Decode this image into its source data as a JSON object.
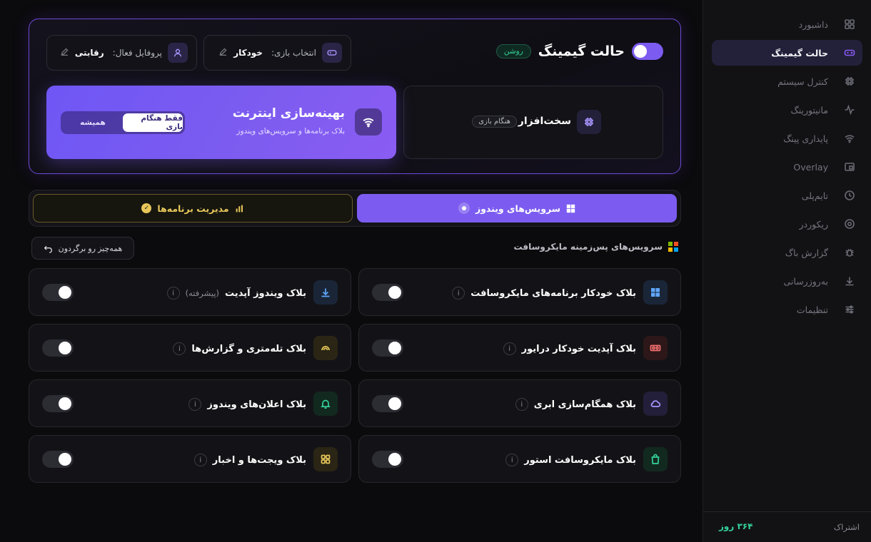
{
  "sidebar": {
    "items": [
      {
        "label": "داشبورد",
        "icon": "grid-icon",
        "active": false
      },
      {
        "label": "حالت گیمینگ",
        "icon": "gamepad-icon",
        "active": true
      },
      {
        "label": "کنترل سیستم",
        "icon": "cpu-icon",
        "active": false
      },
      {
        "label": "مانیتورینگ",
        "icon": "activity-icon",
        "active": false
      },
      {
        "label": "پایداری پینگ",
        "icon": "wifi-icon",
        "active": false
      },
      {
        "label": "Overlay",
        "icon": "overlay-icon",
        "active": false
      },
      {
        "label": "تایم‌پلی",
        "icon": "clock-icon",
        "active": false
      },
      {
        "label": "ریکوردر",
        "icon": "record-icon",
        "active": false
      },
      {
        "label": "گزارش باگ",
        "icon": "bug-icon",
        "active": false
      },
      {
        "label": "به‌روزرسانی",
        "icon": "download-icon",
        "active": false
      },
      {
        "label": "تنظیمات",
        "icon": "sliders-icon",
        "active": false
      }
    ],
    "subscription": {
      "label": "اشتراک",
      "days": "۳۶۴ روز"
    }
  },
  "gaming": {
    "title": "حالت گیمینگ",
    "status": "روشن",
    "enabled": true,
    "game_select": {
      "label": "انتخاب بازی:",
      "value": "خودکار"
    },
    "profile": {
      "label": "پروفایل فعال:",
      "value": "رقابتی"
    },
    "hardware": {
      "title": "سخت‌افزار",
      "badge": "هنگام بازی"
    },
    "internet": {
      "title": "بهینه‌سازی اینترنت",
      "subtitle": "بلاک برنامه‌ها و سرویس‌های ویندوز",
      "options": [
        "فقط هنگام بازی",
        "همیشه"
      ],
      "selected": "فقط هنگام بازی"
    }
  },
  "tabs": {
    "services": "سرویس‌های ویندوز",
    "apps": "مدیریت برنامه‌ها",
    "active": "services"
  },
  "section": {
    "title": "سرویس‌های پس‌زمینه مایکروسافت",
    "reset": "همه‌چیز رو برگردون"
  },
  "services": [
    {
      "label": "بلاک خودکار برنامه‌های مایکروسافت",
      "note": "",
      "icon": "windows-icon",
      "color": "#60a5fa",
      "bg": "#1a2638",
      "enabled": false
    },
    {
      "label": "بلاک ویندوز آپدیت",
      "note": "(پیشرفته)",
      "icon": "download-icon",
      "color": "#60a5fa",
      "bg": "#1a2638",
      "enabled": false
    },
    {
      "label": "بلاک آپدیت خودکار درایور",
      "note": "",
      "icon": "gpu-icon",
      "color": "#f87171",
      "bg": "#2d1718",
      "enabled": false
    },
    {
      "label": "بلاک تله‌متری و گزارش‌ها",
      "note": "",
      "icon": "signal-icon",
      "color": "#e8c75a",
      "bg": "#2a2514",
      "enabled": false
    },
    {
      "label": "بلاک همگام‌سازی ابری",
      "note": "",
      "icon": "cloud-icon",
      "color": "#a996ff",
      "bg": "#231f3a",
      "enabled": false
    },
    {
      "label": "بلاک اعلان‌های ویندوز",
      "note": "",
      "icon": "bell-icon",
      "color": "#34d399",
      "bg": "#12291f",
      "enabled": false
    },
    {
      "label": "بلاک مایکروسافت استور",
      "note": "",
      "icon": "store-icon",
      "color": "#34d399",
      "bg": "#12291f",
      "enabled": false
    },
    {
      "label": "بلاک ویجت‌ها و اخبار",
      "note": "",
      "icon": "widgets-icon",
      "color": "#e8c75a",
      "bg": "#2a2514",
      "enabled": false
    }
  ],
  "colors": {
    "accent": "#7c5cf0",
    "success": "#34d399",
    "warning": "#e8c75a"
  }
}
